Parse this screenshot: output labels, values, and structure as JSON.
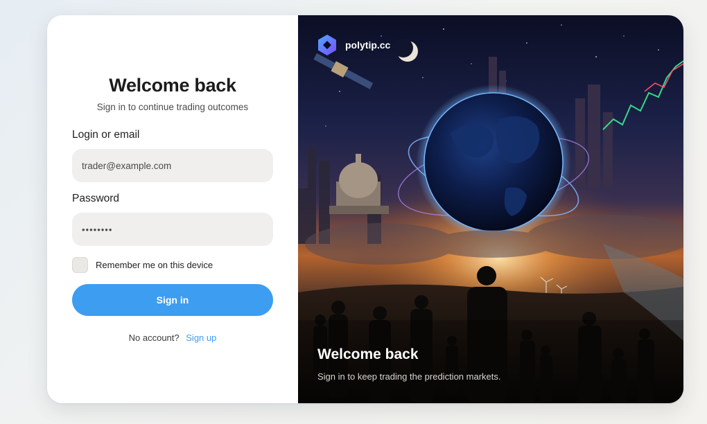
{
  "login": {
    "title": "Welcome back",
    "subtitle": "Sign in to continue trading outcomes",
    "login_label": "Login or email",
    "login_value": "trader@example.com",
    "password_label": "Password",
    "password_value": "••••••••",
    "remember_label": "Remember me on this device",
    "remember_checked": false,
    "signin_label": "Sign in",
    "no_account_text": "No account?",
    "signup_label": "Sign up"
  },
  "hero": {
    "brand_name": "polytip.cc",
    "title": "Welcome back",
    "subtitle": "Sign in to keep trading the prediction markets."
  },
  "colors": {
    "accent": "#3d9df0",
    "input_bg": "#f0efed",
    "text_dark": "#1c1c1c"
  }
}
